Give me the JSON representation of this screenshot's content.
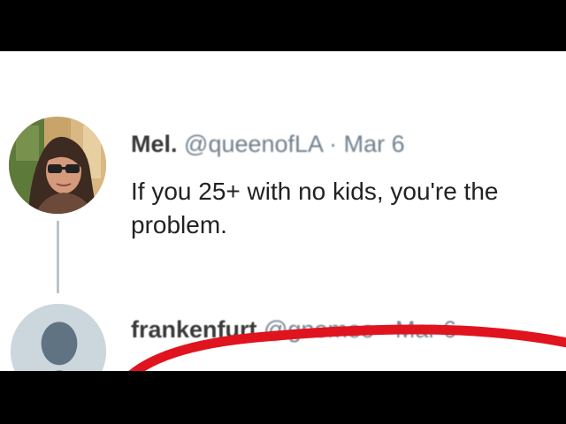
{
  "tweets": [
    {
      "display_name": "Mel.",
      "handle": "@queenofLA",
      "separator": "·",
      "date": "Mar 6",
      "text": "If you 25+ with no kids, you're the problem.",
      "avatar_icon": "woman-with-glasses-photo"
    },
    {
      "display_name": "frankenfurt",
      "handle": "@gnomeo",
      "separator": "·",
      "date": "Mar 6",
      "text": "",
      "avatar_icon": "default-profile-silhouette"
    }
  ],
  "annotation": {
    "shape": "hand-drawn-circle",
    "color": "#e0141e"
  },
  "colors": {
    "letterbox": "#000000",
    "background": "#ffffff",
    "name": "#3a3a3a",
    "meta": "#6f7f8c",
    "body": "#222222",
    "thread_line": "#b8c4cc"
  }
}
